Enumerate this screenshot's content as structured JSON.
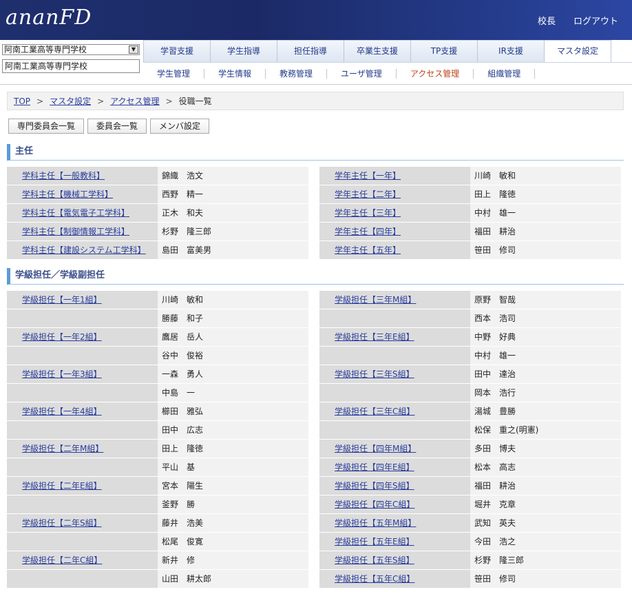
{
  "header": {
    "logo": "ananFD",
    "user_link": "校長",
    "logout_link": "ログアウト"
  },
  "school": {
    "select_value": "阿南工業高等専門学校",
    "input_value": "阿南工業高等専門学校"
  },
  "main_tabs": [
    "学習支援",
    "学生指導",
    "担任指導",
    "卒業生支援",
    "TP支援",
    "IR支援",
    "マスタ設定"
  ],
  "main_tab_active": "マスタ設定",
  "sub_tabs": [
    "学生管理",
    "学生情報",
    "教務管理",
    "ユーザ管理",
    "アクセス管理",
    "組織管理"
  ],
  "sub_tab_active": "アクセス管理",
  "breadcrumb": {
    "items": [
      "TOP",
      "マスタ設定",
      "アクセス管理"
    ],
    "current": "役職一覧",
    "sep": ">"
  },
  "buttons": [
    "専門委員会一覧",
    "委員会一覧",
    "メンバ設定"
  ],
  "sections": {
    "shunin": {
      "title": "主任",
      "left": [
        {
          "role": "学科主任【一般教科】",
          "name": "錦織　浩文"
        },
        {
          "role": "学科主任【機械工学科】",
          "name": "西野　精一"
        },
        {
          "role": "学科主任【電気電子工学科】",
          "name": "正木　和夫"
        },
        {
          "role": "学科主任【制御情報工学科】",
          "name": "杉野　隆三郎"
        },
        {
          "role": "学科主任【建設システム工学科】",
          "name": "島田　富美男"
        }
      ],
      "right": [
        {
          "role": "学年主任【一年】",
          "name": "川崎　敏和"
        },
        {
          "role": "学年主任【二年】",
          "name": "田上　隆徳"
        },
        {
          "role": "学年主任【三年】",
          "name": "中村　雄一"
        },
        {
          "role": "学年主任【四年】",
          "name": "福田　耕治"
        },
        {
          "role": "学年主任【五年】",
          "name": "笹田　修司"
        }
      ]
    },
    "tannin": {
      "title": "学級担任／学級副担任",
      "left": [
        {
          "role": "学級担任【一年1組】",
          "name": "川崎　敏和"
        },
        {
          "role": "",
          "name": "勝藤　和子"
        },
        {
          "role": "学級担任【一年2組】",
          "name": "鷹居　岳人"
        },
        {
          "role": "",
          "name": "谷中　俊裕"
        },
        {
          "role": "学級担任【一年3組】",
          "name": "一森　勇人"
        },
        {
          "role": "",
          "name": "中島　一"
        },
        {
          "role": "学級担任【一年4組】",
          "name": "櫛田　雅弘"
        },
        {
          "role": "",
          "name": "田中　広志"
        },
        {
          "role": "学級担任【二年M組】",
          "name": "田上　隆徳"
        },
        {
          "role": "",
          "name": "平山　基"
        },
        {
          "role": "学級担任【二年E組】",
          "name": "宮本　陽生"
        },
        {
          "role": "",
          "name": "釜野　勝"
        },
        {
          "role": "学級担任【二年S組】",
          "name": "藤井　浩美"
        },
        {
          "role": "",
          "name": "松尾　俊寛"
        },
        {
          "role": "学級担任【二年C組】",
          "name": "新井　修"
        },
        {
          "role": "",
          "name": "山田　耕太郎"
        }
      ],
      "right": [
        {
          "role": "学級担任【三年M組】",
          "name": "原野　智哉"
        },
        {
          "role": "",
          "name": "西本　浩司"
        },
        {
          "role": "学級担任【三年E組】",
          "name": "中野　好典"
        },
        {
          "role": "",
          "name": "中村　雄一"
        },
        {
          "role": "学級担任【三年S組】",
          "name": "田中　達治"
        },
        {
          "role": "",
          "name": "岡本　浩行"
        },
        {
          "role": "学級担任【三年C組】",
          "name": "湯城　豊勝"
        },
        {
          "role": "",
          "name": "松保　重之(明憲)"
        },
        {
          "role": "学級担任【四年M組】",
          "name": "多田　博夫"
        },
        {
          "role": "学級担任【四年E組】",
          "name": "松本　高志"
        },
        {
          "role": "学級担任【四年S組】",
          "name": "福田　耕治"
        },
        {
          "role": "学級担任【四年C組】",
          "name": "堀井　克章"
        },
        {
          "role": "学級担任【五年M組】",
          "name": "武知　英夫"
        },
        {
          "role": "学級担任【五年E組】",
          "name": "今田　浩之"
        },
        {
          "role": "学級担任【五年S組】",
          "name": "杉野　隆三郎"
        },
        {
          "role": "学級担任【五年C組】",
          "name": "笹田　修司"
        }
      ]
    }
  }
}
